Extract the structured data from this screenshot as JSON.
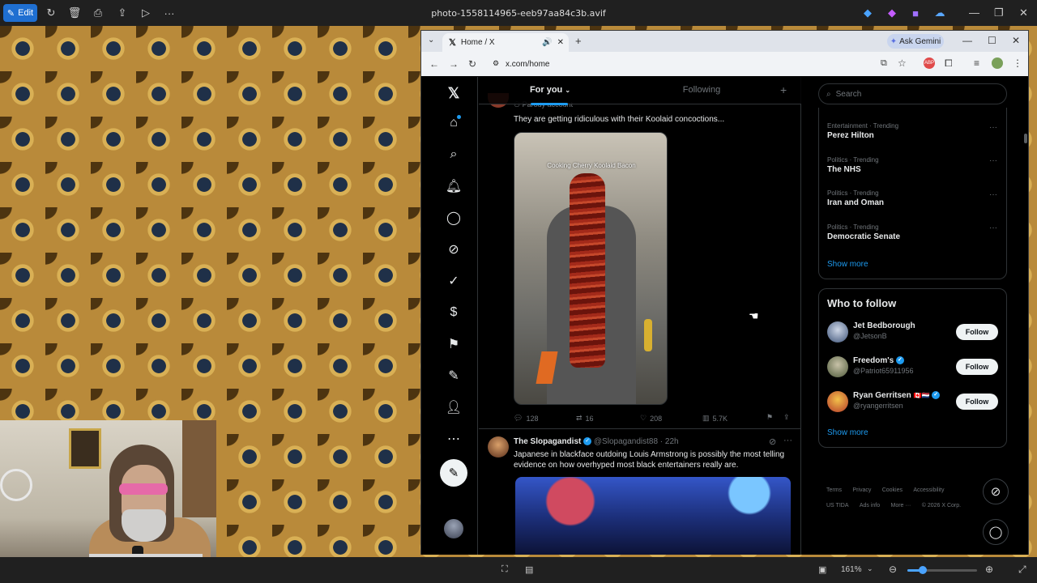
{
  "viewer": {
    "edit_label": "Edit",
    "title": "photo-1558114965-eeb97aa84c3b.avif",
    "zoom": "161%"
  },
  "browser": {
    "tab_title": "Home / X",
    "url": "x.com/home",
    "gemini_label": "Ask Gemini"
  },
  "feed": {
    "tabs": {
      "for_you": "For you",
      "following": "Following"
    },
    "tweet1": {
      "badge": "Parody account",
      "text": "They are getting ridiculous with their Koolaid concoctions...",
      "video_caption": "Cooking Cherry Koolaid Bacon",
      "replies": "128",
      "reposts": "16",
      "likes": "208",
      "views": "5.7K"
    },
    "tweet2": {
      "name": "The Slopagandist",
      "handle": "@Slopagandist88",
      "time": "· 22h",
      "text": "Japanese in blackface outdoing Louis Armstrong is possibly the most telling evidence on how overhyped most black entertainers really are."
    }
  },
  "right": {
    "search_placeholder": "Search",
    "trends": [
      {
        "category": "Entertainment · Trending",
        "name": "Perez Hilton"
      },
      {
        "category": "Politics · Trending",
        "name": "The NHS"
      },
      {
        "category": "Politics · Trending",
        "name": "Iran and Oman"
      },
      {
        "category": "Politics · Trending",
        "name": "Democratic Senate"
      }
    ],
    "show_more": "Show more",
    "who_to_follow_title": "Who to follow",
    "who_to_follow": [
      {
        "name": "Jet Bedborough",
        "handle": "@JetsonB",
        "button": "Follow"
      },
      {
        "name": "Freedom's",
        "handle": "@Patriot65911956",
        "button": "Follow"
      },
      {
        "name": "Ryan Gerritsen",
        "handle": "@ryangerritsen",
        "button": "Follow"
      }
    ],
    "wtf_show_more": "Show more",
    "footer": {
      "terms": "Terms",
      "privacy": "Privacy",
      "cookies": "Cookies",
      "accessibility": "Accessibility",
      "us_tida": "US TIDA",
      "ads_info": "Ads info",
      "more": "More ···",
      "copyright": "© 2026 X Corp."
    }
  },
  "colors": {
    "accent": "#1d9bf0",
    "background": "#000000",
    "viewer_edit": "#1f6fd1"
  }
}
